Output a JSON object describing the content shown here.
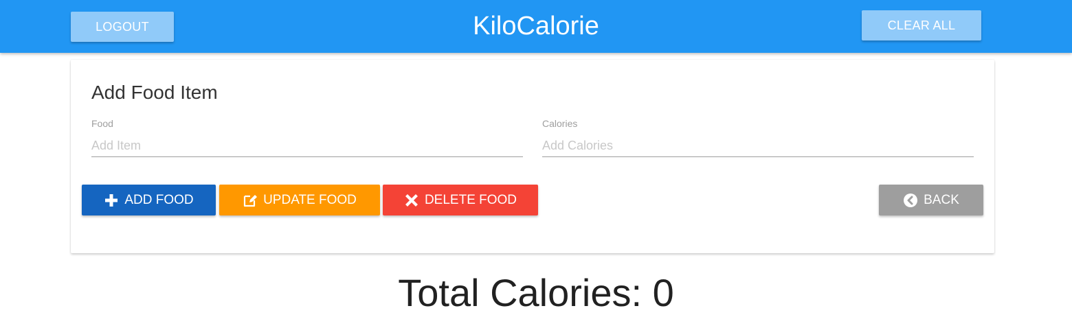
{
  "navbar": {
    "brand": "KiloCalorie",
    "logout_label": "Logout",
    "clear_all_label": "Clear All",
    "color": "#2196f3"
  },
  "card": {
    "title": "Add Food Item",
    "food_field": {
      "label": "Food",
      "placeholder": "Add Item",
      "value": ""
    },
    "calories_field": {
      "label": "Calories",
      "placeholder": "Add Calories",
      "value": ""
    },
    "buttons": {
      "add": {
        "label": "Add Food",
        "icon": "plus-icon",
        "color": "#1565c0"
      },
      "update": {
        "label": "Update Food",
        "icon": "edit-icon",
        "color": "#ff9800"
      },
      "delete": {
        "label": "Delete Food",
        "icon": "close-icon",
        "color": "#f44336"
      },
      "back": {
        "label": "Back",
        "icon": "chevron-left-circle-icon",
        "color": "#9e9e9e"
      }
    }
  },
  "total": {
    "label": "Total Calories:",
    "value": "0"
  }
}
